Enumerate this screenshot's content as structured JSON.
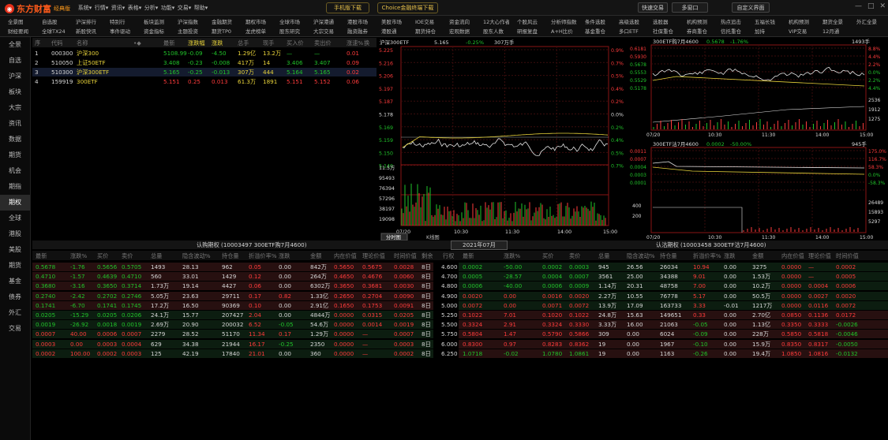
{
  "app": {
    "name": "东方财富",
    "edition": "经典版"
  },
  "menu": [
    "系统",
    "行情",
    "资讯",
    "表格",
    "分析",
    "功能",
    "交易",
    "帮助"
  ],
  "top_buttons": {
    "mobile": "手机版下载",
    "choice": "Choice金融终端下载",
    "quick": "快速交易",
    "multi_window": "多窗口",
    "custom": "自定义界面"
  },
  "nav_row1": [
    "全景图",
    "自选股",
    "沪深排行",
    "特别行",
    "板块监测",
    "沪深指数",
    "金融期货",
    "期权市场",
    "全球市场",
    "沪深港通",
    "港股市场",
    "美股市场",
    "IOE交易",
    "资金流向",
    "12大心作者",
    "个股风云",
    "分析师指数",
    "条件选股",
    "高级选股",
    "选股器",
    "机构预测",
    "热点追击",
    "五福长钱",
    "机构预测",
    "期货全景",
    "外汇全景"
  ],
  "nav_row2": [
    "财经要闻",
    "全球TX24",
    "新股快讯",
    "事件驱动",
    "资金指标",
    "主题投资",
    "期货TP0",
    "龙虎榜单",
    "股东研究",
    "大宗交易",
    "融资融券",
    "港股通",
    "期货持仓",
    "宏观数据",
    "股东人数",
    "研报复盘",
    "A+H比价",
    "基金重仓",
    "多口ETF",
    "社保重仓",
    "券商重仓",
    "信托重仓",
    "加持",
    "VIP交易",
    "12月通"
  ],
  "sidebar": [
    "全景",
    "自选",
    "沪深",
    "板块",
    "大宗",
    "资讯",
    "数据",
    "期货",
    "机会",
    "期指",
    "期权",
    "全球",
    "港股",
    "美股",
    "期货",
    "基金",
    "债券",
    "外汇",
    "交易"
  ],
  "quote_table": {
    "headers": [
      "序",
      "代码",
      "名称",
      "•◆",
      "最新",
      "涨跌幅",
      "涨跌",
      "总手",
      "现手",
      "买入价",
      "卖出价",
      "涨速%",
      "换"
    ],
    "rows": [
      {
        "n": "1",
        "code": "000300",
        "name": "沪深300",
        "last": "5108.99",
        "pct": "-0.09",
        "chg": "-4.50",
        "vol": "1.29亿",
        "cur": "13.2万",
        "bid": "—",
        "ask": "—",
        "spd": "0.01"
      },
      {
        "n": "2",
        "code": "510050",
        "name": "上证50ETF",
        "last": "3.408",
        "pct": "-0.23",
        "chg": "-0.008",
        "vol": "417万",
        "cur": "14",
        "bid": "3.406",
        "ask": "3.407",
        "spd": "0.09"
      },
      {
        "n": "3",
        "code": "510300",
        "name": "沪深300ETF",
        "last": "5.165",
        "pct": "-0.25",
        "chg": "-0.013",
        "vol": "307万",
        "cur": "444",
        "bid": "5.164",
        "ask": "5.165",
        "spd": "0.02"
      },
      {
        "n": "4",
        "code": "159919",
        "name": "300ETF",
        "last": "5.151",
        "pct": "0.25",
        "chg": "0.013",
        "vol": "61.3万",
        "cur": "1891",
        "bid": "5.151",
        "ask": "5.152",
        "spd": "0.06"
      }
    ]
  },
  "etf_chart": {
    "title": "沪深300ETF",
    "price": "5.165",
    "pct": "-0.25%",
    "vol": "307万手",
    "y_left": [
      "5.225",
      "5.216",
      "5.206",
      "5.197",
      "5.187",
      "5.178",
      "5.169",
      "5.159",
      "5.150",
      "5.140"
    ],
    "y_right": [
      "0.9%",
      "0.7%",
      "0.5%",
      "0.4%",
      "0.2%",
      "0.0%",
      "0.2%",
      "0.4%",
      "0.5%",
      "0.7%"
    ],
    "vol_left": [
      "11.5万",
      "95493",
      "76394",
      "57296",
      "38197",
      "19098"
    ],
    "x": [
      "07/20",
      "10:30",
      "11:30",
      "14:00",
      "15:00"
    ],
    "tabs": [
      "分时图",
      "K线图"
    ]
  },
  "right_chart1": {
    "title": "300ETF购7月4600",
    "price": "0.5678",
    "pct": "-1.76%",
    "vol": "1493手",
    "y_left": [
      "0.6181",
      "0.5930",
      "0.5678",
      "0.5553",
      "0.5529",
      "0.5178"
    ],
    "y_right": [
      "8.8%",
      "4.4%",
      "2.2%",
      "0.0%",
      "2.2%",
      "4.4%"
    ],
    "vol_r": [
      "2536",
      "1912",
      "1275"
    ],
    "x": [
      "07/20",
      "10:30",
      "11:30",
      "14:00",
      "15:00"
    ]
  },
  "right_chart2": {
    "title": "300ETF沽7月4600",
    "price": "0.0002",
    "pct": "-50.00%",
    "vol": "945手",
    "y_left": [
      "0.0011",
      "0.0007",
      "0.0004",
      "0.0003",
      "0.0001"
    ],
    "y_right": [
      "175.0%",
      "116.7%",
      "58.3%",
      "0.0%",
      "-58.3%"
    ],
    "vol_l": [
      "400",
      "200"
    ],
    "vol_r": [
      "26489",
      "15893",
      "5297"
    ],
    "x": [
      "07/20",
      "10:30",
      "11:30",
      "14:00",
      "15:00"
    ]
  },
  "option_header": {
    "left_title": "认购期权 (10003497  300ETF购7月4600)",
    "month": "2021年07月",
    "right_title": "认沽期权 (10003458  300ETF沽7月4600)"
  },
  "option_cols_left": [
    "最新",
    "涨跌%",
    "买价",
    "卖价",
    "总量",
    "隐含波动%",
    "持仓量",
    "折溢价率%",
    "涨跌",
    "金额",
    "内在价值",
    "理论价值",
    "时间价值",
    "剩余"
  ],
  "option_cols_mid": [
    "行权"
  ],
  "option_cols_right": [
    "最新",
    "涨跌%",
    "买价",
    "卖价",
    "总量",
    "隐含波动%",
    "持仓量",
    "折溢价率%",
    "涨跌",
    "金额",
    "内在价值",
    "理论价值",
    "时间价值"
  ],
  "option_rows": [
    {
      "L": [
        "0.5678",
        "-1.76",
        "0.5656",
        "0.5705",
        "1493",
        "28.13",
        "962",
        "0.05",
        "0.00",
        "842万",
        "0.5650",
        "0.5675",
        "0.0028"
      ],
      "days": "8日",
      "K": "4.600",
      "R": [
        "0.0002",
        "-50.00",
        "0.0002",
        "0.0003",
        "945",
        "26.56",
        "26034",
        "10.94",
        "0.00",
        "3275",
        "0.0000",
        "—",
        "0.0002"
      ]
    },
    {
      "L": [
        "0.4710",
        "-1.57",
        "0.4639",
        "0.4710",
        "560",
        "33.01",
        "1429",
        "0.12",
        "0.00",
        "264万",
        "0.4650",
        "0.4676",
        "0.0060"
      ],
      "days": "8日",
      "K": "4.700",
      "R": [
        "0.0005",
        "-28.57",
        "0.0004",
        "0.0007",
        "3561",
        "25.00",
        "34388",
        "9.01",
        "0.00",
        "1.53万",
        "0.0000",
        "—",
        "0.0005"
      ]
    },
    {
      "L": [
        "0.3680",
        "-3.16",
        "0.3650",
        "0.3714",
        "1.73万",
        "19.14",
        "4427",
        "0.06",
        "0.00",
        "6302万",
        "0.3650",
        "0.3681",
        "0.0030"
      ],
      "days": "8日",
      "K": "4.800",
      "R": [
        "0.0006",
        "-40.00",
        "0.0006",
        "0.0009",
        "1.14万",
        "20.31",
        "48758",
        "7.00",
        "0.00",
        "10.2万",
        "0.0000",
        "0.0004",
        "0.0006"
      ]
    },
    {
      "L": [
        "0.2740",
        "-2.42",
        "0.2702",
        "0.2746",
        "5.05万",
        "23.63",
        "29711",
        "0.17",
        "0.82",
        "1.33亿",
        "0.2650",
        "0.2704",
        "0.0090"
      ],
      "days": "8日",
      "K": "4.900",
      "R": [
        "0.0020",
        "0.00",
        "0.0016",
        "0.0020",
        "2.27万",
        "10.55",
        "76778",
        "5.17",
        "0.00",
        "50.5万",
        "0.0000",
        "0.0027",
        "0.0020"
      ]
    },
    {
      "L": [
        "0.1741",
        "-6.70",
        "0.1741",
        "0.1745",
        "17.2万",
        "16.50",
        "90369",
        "0.10",
        "0.00",
        "2.91亿",
        "0.1650",
        "0.1753",
        "0.0091"
      ],
      "days": "8日",
      "K": "5.000",
      "R": [
        "0.0072",
        "0.00",
        "0.0071",
        "0.0072",
        "13.9万",
        "17.09",
        "163733",
        "3.33",
        "-0.01",
        "1217万",
        "0.0000",
        "0.0116",
        "0.0072"
      ]
    },
    {
      "L": [
        "0.0205",
        "-15.29",
        "0.0205",
        "0.0206",
        "24.1万",
        "15.77",
        "207427",
        "2.04",
        "0.00",
        "4844万",
        "0.0000",
        "0.0315",
        "0.0205"
      ],
      "days": "8日",
      "K": "5.250",
      "R": [
        "0.1022",
        "7.01",
        "0.1020",
        "0.1022",
        "24.8万",
        "15.63",
        "149651",
        "0.33",
        "0.00",
        "2.70亿",
        "0.0850",
        "0.1136",
        "0.0172"
      ]
    },
    {
      "L": [
        "0.0019",
        "-26.92",
        "0.0018",
        "0.0019",
        "2.69万",
        "20.90",
        "200032",
        "6.52",
        "-0.05",
        "54.6万",
        "0.0000",
        "0.0014",
        "0.0019"
      ],
      "days": "8日",
      "K": "5.500",
      "R": [
        "0.3324",
        "2.91",
        "0.3324",
        "0.3330",
        "3.33万",
        "16.00",
        "21063",
        "-0.05",
        "0.00",
        "1.13亿",
        "0.3350",
        "0.3333",
        "-0.0026"
      ]
    },
    {
      "L": [
        "0.0007",
        "40.00",
        "0.0006",
        "0.0007",
        "2279",
        "28.52",
        "51170",
        "11.34",
        "0.17",
        "1.29万",
        "0.0000",
        "—",
        "0.0007"
      ],
      "days": "8日",
      "K": "5.750",
      "R": [
        "0.5804",
        "1.47",
        "0.5790",
        "0.5866",
        "309",
        "0.00",
        "6024",
        "-0.09",
        "0.00",
        "228万",
        "0.5850",
        "0.5818",
        "-0.0046"
      ]
    },
    {
      "L": [
        "0.0003",
        "0.00",
        "0.0003",
        "0.0004",
        "629",
        "34.38",
        "21944",
        "16.17",
        "-0.25",
        "2350",
        "0.0000",
        "—",
        "0.0003"
      ],
      "days": "8日",
      "K": "6.000",
      "R": [
        "0.8300",
        "0.97",
        "0.8283",
        "0.8362",
        "19",
        "0.00",
        "1967",
        "-0.10",
        "0.00",
        "15.9万",
        "0.8350",
        "0.8317",
        "-0.0050"
      ]
    },
    {
      "L": [
        "0.0002",
        "100.00",
        "0.0002",
        "0.0003",
        "125",
        "42.19",
        "17840",
        "21.01",
        "0.00",
        "360",
        "0.0000",
        "—",
        "0.0002"
      ],
      "days": "8日",
      "K": "6.250",
      "R": [
        "1.0718",
        "-0.02",
        "1.0780",
        "1.0861",
        "19",
        "0.00",
        "1163",
        "-0.26",
        "0.00",
        "19.4万",
        "1.0850",
        "1.0816",
        "-0.0132"
      ]
    }
  ]
}
